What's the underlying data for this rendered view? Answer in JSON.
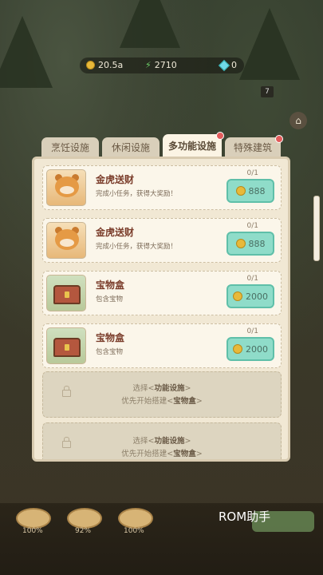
{
  "resources": {
    "coins": "20.5a",
    "energy": "2710",
    "gems": "0"
  },
  "floating_badge": "7",
  "tabs": [
    {
      "label": "烹饪设施"
    },
    {
      "label": "休闲设施"
    },
    {
      "label": "多功能设施"
    },
    {
      "label": "特殊建筑"
    }
  ],
  "items": [
    {
      "title": "金虎送财",
      "desc": "完成小任务，获得大奖励！",
      "count": "0/1",
      "price": "888",
      "icon": "tiger-icon"
    },
    {
      "title": "金虎送财",
      "desc": "完成小任务，获得大奖励！",
      "count": "0/1",
      "price": "888",
      "icon": "tiger-icon"
    },
    {
      "title": "宝物盒",
      "desc": "包含宝物",
      "count": "0/1",
      "price": "2000",
      "icon": "chest-icon"
    },
    {
      "title": "宝物盒",
      "desc": "包含宝物",
      "count": "0/1",
      "price": "2000",
      "icon": "chest-icon"
    }
  ],
  "locked": [
    {
      "line1_pre": "选择<",
      "line1_bold": "功能设施",
      "line1_post": ">",
      "line2_pre": "优先开始搭建<",
      "line2_bold": "宝物盒",
      "line2_post": ">"
    },
    {
      "line1_pre": "选择<",
      "line1_bold": "功能设施",
      "line1_post": ">",
      "line2_pre": "优先开始搭建<",
      "line2_bold": "宝物盒",
      "line2_post": ">"
    }
  ],
  "bottom": {
    "pots": [
      "100%",
      "92%",
      "100%"
    ],
    "watermark": "ROM助手"
  },
  "colors": {
    "accent": "#8fdcc9",
    "panel": "#f1e8d4",
    "title": "#7a3c2a"
  }
}
